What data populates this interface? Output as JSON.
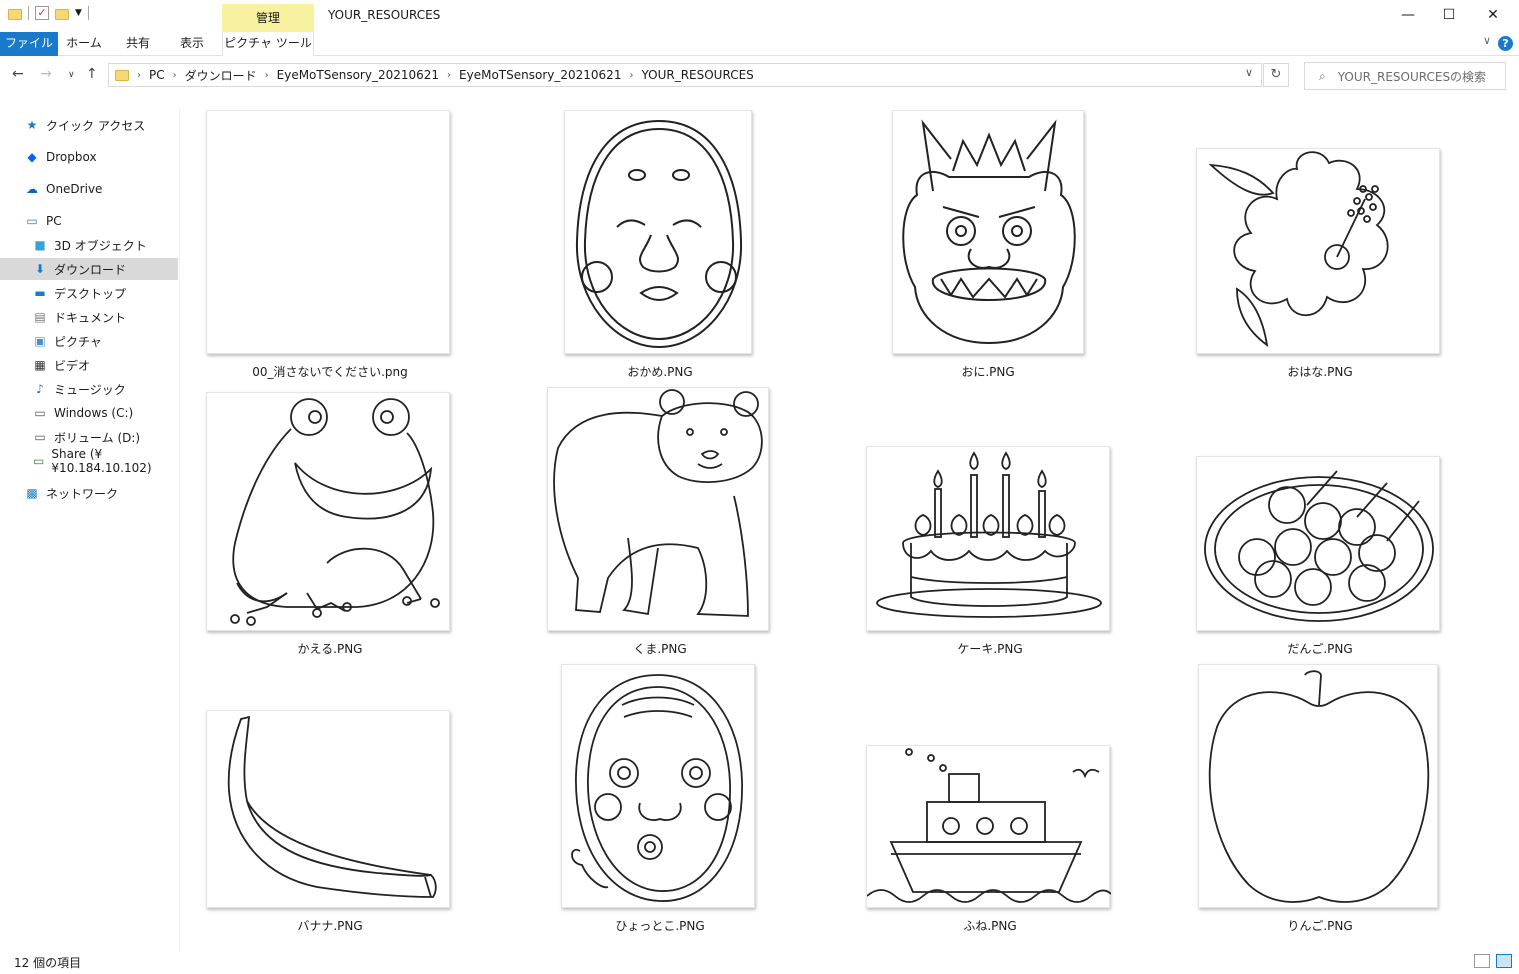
{
  "window": {
    "title": "YOUR_RESOURCES",
    "context_tab": "管理",
    "minimize": "—",
    "maximize": "☐",
    "close": "✕"
  },
  "ribbon": {
    "tabs": [
      "ファイル",
      "ホーム",
      "共有",
      "表示",
      "ピクチャ ツール"
    ],
    "help": "?"
  },
  "address": {
    "crumbs": [
      "PC",
      "ダウンロード",
      "EyeMoTSensory_20210621",
      "EyeMoTSensory_20210621",
      "YOUR_RESOURCES"
    ],
    "search_placeholder": "YOUR_RESOURCESの検索"
  },
  "sidebar": {
    "items": [
      {
        "label": "クイック アクセス",
        "icon": "star-icon"
      },
      {
        "label": "Dropbox",
        "icon": "dropbox-icon"
      },
      {
        "label": "OneDrive",
        "icon": "cloud-icon"
      },
      {
        "label": "PC",
        "icon": "computer-icon"
      },
      {
        "label": "3D オブジェクト",
        "icon": "cube-icon"
      },
      {
        "label": "ダウンロード",
        "icon": "download-icon"
      },
      {
        "label": "デスクトップ",
        "icon": "desktop-icon"
      },
      {
        "label": "ドキュメント",
        "icon": "document-icon"
      },
      {
        "label": "ピクチャ",
        "icon": "picture-icon"
      },
      {
        "label": "ビデオ",
        "icon": "video-icon"
      },
      {
        "label": "ミュージック",
        "icon": "music-icon"
      },
      {
        "label": "Windows (C:)",
        "icon": "drive-icon"
      },
      {
        "label": "ボリューム (D:)",
        "icon": "drive-icon"
      },
      {
        "label": "Share (¥¥10.184.10.102)",
        "icon": "network-drive-icon"
      },
      {
        "label": "ネットワーク",
        "icon": "network-icon"
      }
    ]
  },
  "files": [
    {
      "name": "00_消さないでください.png",
      "picture": "blank"
    },
    {
      "name": "おかめ.PNG",
      "picture": "okame-mask"
    },
    {
      "name": "おに.PNG",
      "picture": "oni-mask"
    },
    {
      "name": "おはな.PNG",
      "picture": "hibiscus-flower"
    },
    {
      "name": "かえる.PNG",
      "picture": "frog"
    },
    {
      "name": "くま.PNG",
      "picture": "bear"
    },
    {
      "name": "ケーキ.PNG",
      "picture": "birthday-cake"
    },
    {
      "name": "だんご.PNG",
      "picture": "dango"
    },
    {
      "name": "バナナ.PNG",
      "picture": "banana"
    },
    {
      "name": "ひょっとこ.PNG",
      "picture": "hyottoko-mask"
    },
    {
      "name": "ふね.PNG",
      "picture": "ship"
    },
    {
      "name": "りんご.PNG",
      "picture": "apple"
    }
  ],
  "status": {
    "item_count": "12 個の項目"
  }
}
